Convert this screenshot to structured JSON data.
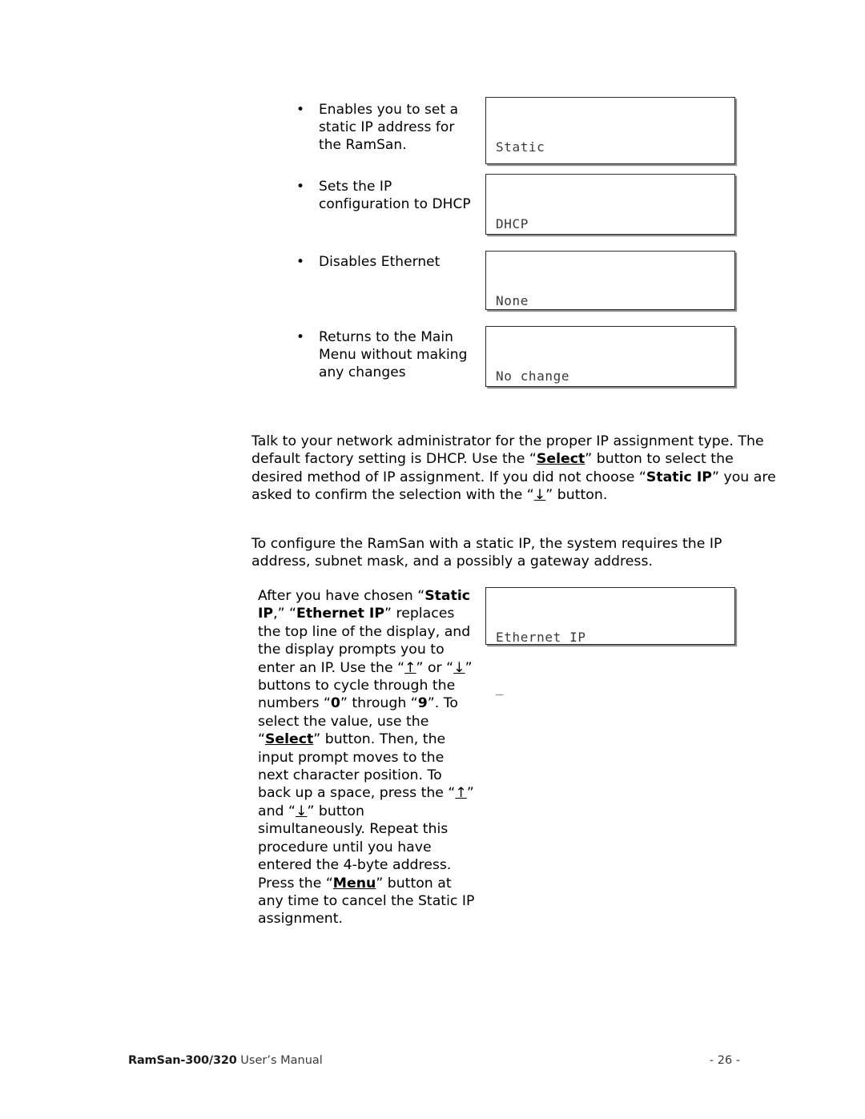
{
  "document": {
    "title": "RamSan-300/320 User's Manual",
    "page_label": "- 26 -",
    "footer_brand": "RamSan-300/320",
    "footer_sub": " User’s Manual"
  },
  "menu_options": [
    {
      "bullet": "•",
      "description": "Enables you to set a static IP address for the RamSan.",
      "lcd_line1": "Static",
      "lcd_line2": ""
    },
    {
      "bullet": "•",
      "description": "Sets the IP configuration to DHCP",
      "lcd_line1": "DHCP",
      "lcd_line2": ""
    },
    {
      "bullet": "•",
      "description": "Disables Ethernet",
      "lcd_line1": "None",
      "lcd_line2": ""
    },
    {
      "bullet": "•",
      "description": "Returns to the Main Menu without making any changes",
      "lcd_line1": "No change",
      "lcd_line2": ""
    }
  ],
  "paragraphs": {
    "p1_part1": "Talk to your network administrator for the proper IP assignment type.  The default factory setting is DHCP.  Use the “",
    "p1_select": "Select",
    "p1_part2": "” button to select the desired method of IP assignment.  If you did not choose “",
    "p1_static_ip": "Static IP",
    "p1_part3": "” you are asked to confirm the selection with the “",
    "p1_arrow_down": "↓",
    "p1_part4": "” button.",
    "p2": "To configure the RamSan with a static IP, the system requires the IP address, subnet mask, and a possibly a gateway address."
  },
  "static_ip_block": {
    "t1": "After you have chosen “",
    "b_static_ip": "Static IP",
    "t2": ",” “",
    "b_ethernet_ip": "Ethernet IP",
    "t3": "” replaces the top line of the display, and the display prompts you to enter an IP. Use the “",
    "arrow_up": "↑",
    "t4": "” or “",
    "arrow_down": "↓",
    "t5": "” buttons to cycle through the numbers “",
    "b_zero": "0",
    "t6": "” through “",
    "b_nine": "9",
    "t7": "”. To select the value, use the “",
    "bu_select": "Select",
    "t8": "” button.  Then, the input prompt moves to the next character position.  To back up a space, press the “",
    "arrow_up2": "↑",
    "t9": "” and “",
    "arrow_down2": "↓",
    "t10": "” button simultaneously.  Repeat this procedure until you have entered the 4-byte address.  Press the “",
    "bu_menu": "Menu",
    "t11": "” button at any time to cancel the Static IP assignment."
  },
  "ethernet_ip_lcd": {
    "line1": "Ethernet IP",
    "line2": "_"
  },
  "colors": {
    "text": "#000000",
    "lcd_text": "#3a3a3a",
    "lcd_border": "#2b2b2b",
    "lcd_shadow": "#8d8d8d"
  }
}
